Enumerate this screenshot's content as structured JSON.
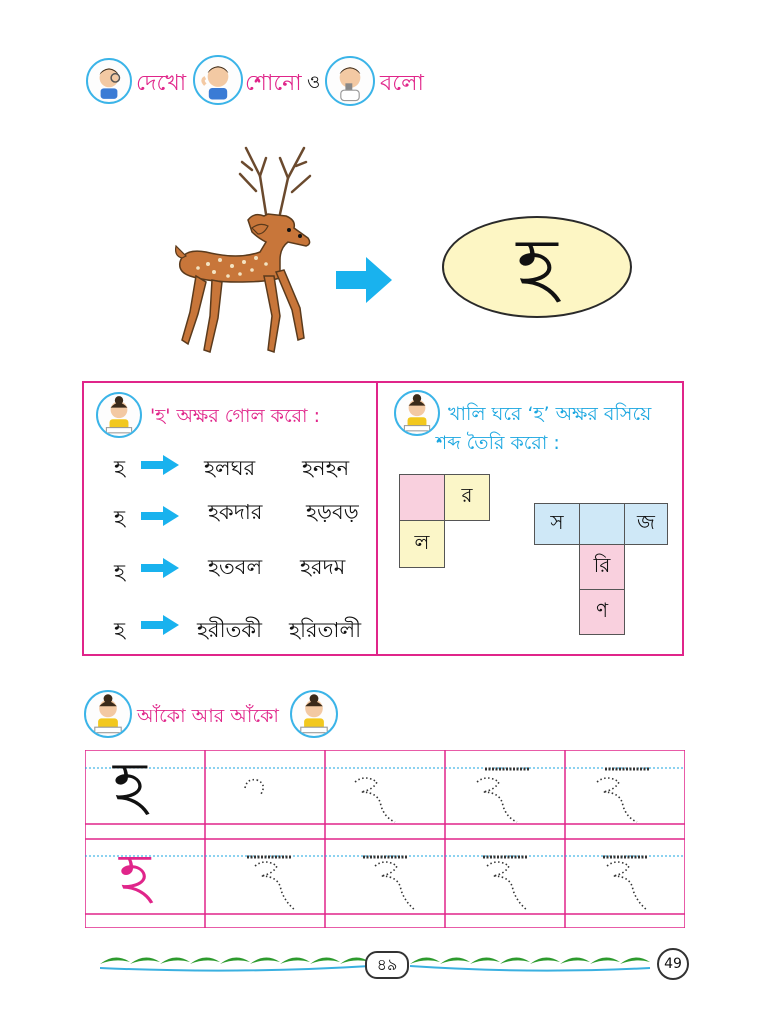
{
  "header": {
    "word_see": "দেখো",
    "word_hear": "শোনো",
    "connector": "ও",
    "word_say": "বলো"
  },
  "hero": {
    "letter": "হ"
  },
  "exercise_circle": {
    "instruction": "'হ' অক্ষর গোল করো :",
    "rows": [
      {
        "letter": "হ",
        "word1": "হলঘর",
        "word2": "হনহন"
      },
      {
        "letter": "হ",
        "word1": "হকদার",
        "word2": "হড়বড়"
      },
      {
        "letter": "হ",
        "word1": "হতবল",
        "word2": "হরদম"
      },
      {
        "letter": "হ",
        "word1": "হরীতকী",
        "word2": "হরিতালী"
      }
    ]
  },
  "exercise_fill": {
    "instruction_line1": "খালি ঘরে ‘হ’ অক্ষর বসিয়ে",
    "instruction_line2": "শব্দ তৈরি করো :",
    "puzzle1": {
      "top_right": "র",
      "bottom_left": "ল"
    },
    "puzzle2": {
      "left": "স",
      "right": "জ",
      "mid": "রি",
      "bottom": "ণ"
    }
  },
  "drawing": {
    "title": "আঁকো আর আঁকো",
    "model_letter": "হ"
  },
  "footer": {
    "page_bengali": "৪৯",
    "page_number": "49"
  },
  "colors": {
    "pink": "#e0258a",
    "cyan": "#1aa6e0",
    "green": "#2e9b2e"
  }
}
